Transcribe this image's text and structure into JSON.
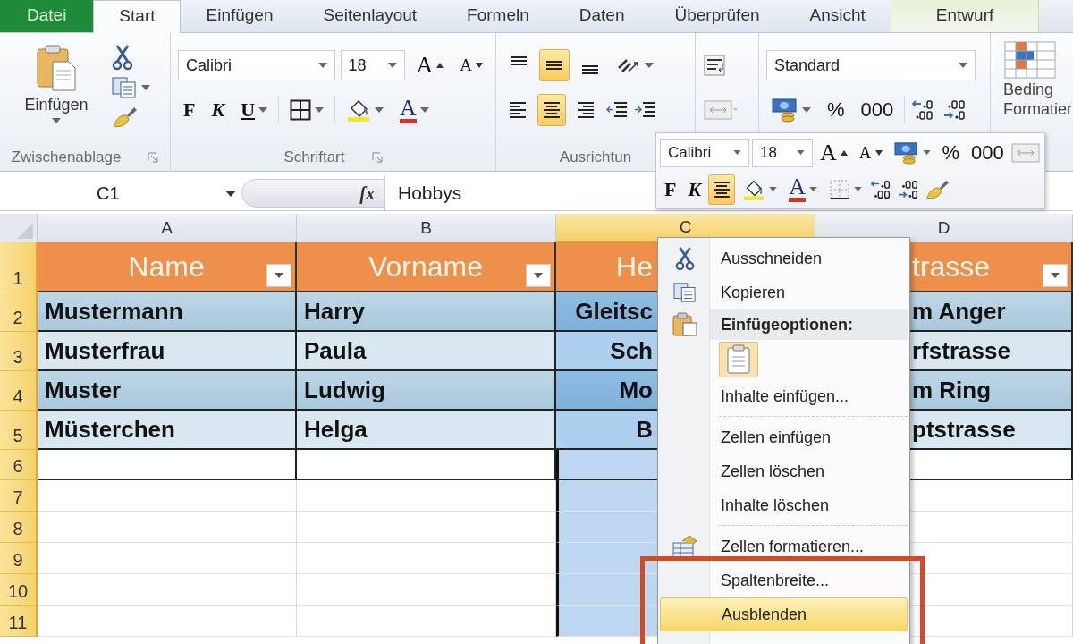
{
  "tabs": [
    {
      "label": "Datei",
      "kind": "file",
      "selected": false
    },
    {
      "label": "Start",
      "kind": "normal",
      "selected": true
    },
    {
      "label": "Einfügen",
      "kind": "normal",
      "selected": false
    },
    {
      "label": "Seitenlayout",
      "kind": "normal",
      "selected": false
    },
    {
      "label": "Formeln",
      "kind": "normal",
      "selected": false
    },
    {
      "label": "Daten",
      "kind": "normal",
      "selected": false
    },
    {
      "label": "Überprüfen",
      "kind": "normal",
      "selected": false
    },
    {
      "label": "Ansicht",
      "kind": "normal",
      "selected": false
    },
    {
      "label": "Entwurf",
      "kind": "contextual",
      "selected": false
    }
  ],
  "ribbon": {
    "clipboard": {
      "paste_label": "Einfügen",
      "group_label": "Zwischenablage"
    },
    "font": {
      "font_name": "Calibri",
      "font_size": "18",
      "grow": "A",
      "shrink": "A",
      "bold": "F",
      "italic": "K",
      "underline": "U",
      "font_color": "A",
      "group_label": "Schriftart"
    },
    "alignment": {
      "buttons": [
        {
          "selected": false
        },
        {
          "selected": true
        },
        {
          "selected": false
        },
        {
          "selected": false
        },
        {
          "selected": true
        },
        {
          "selected": false
        }
      ],
      "group_label": "Ausrichtun"
    },
    "number": {
      "format": "Standard",
      "percent": "%",
      "thousands": "000"
    },
    "styles": {
      "lines": [
        "Beding",
        "Formatier"
      ]
    }
  },
  "formula_bar": {
    "cell": "C1",
    "fx": "fx",
    "value": "Hobbys"
  },
  "mini_toolbar": {
    "font_name": "Calibri",
    "font_size": "18",
    "grow": "A",
    "shrink": "A",
    "percent": "%",
    "thousands": "000",
    "bold": "F",
    "italic": "K",
    "center_selected": true,
    "font_color": "A"
  },
  "sheet": {
    "columns": [
      {
        "label": "A",
        "selected": false
      },
      {
        "label": "B",
        "selected": false
      },
      {
        "label": "C",
        "selected": true
      },
      {
        "label": "D",
        "selected": false
      }
    ],
    "rows": [
      {
        "number": "1",
        "kind": "header",
        "cells": [
          {
            "text": "Name",
            "filter": true
          },
          {
            "text": "Vorname",
            "filter": true
          },
          {
            "text": "He",
            "filter": false
          },
          {
            "text": "trasse",
            "filter": true
          }
        ]
      },
      {
        "number": "2",
        "kind": "data",
        "cells": [
          {
            "text": "Mustermann"
          },
          {
            "text": "Harry"
          },
          {
            "text": "Gleitsc"
          },
          {
            "text": "m Anger"
          }
        ]
      },
      {
        "number": "3",
        "kind": "data",
        "cells": [
          {
            "text": "Musterfrau"
          },
          {
            "text": "Paula"
          },
          {
            "text": "Sch"
          },
          {
            "text": "rfstrasse"
          }
        ]
      },
      {
        "number": "4",
        "kind": "data",
        "cells": [
          {
            "text": "Muster"
          },
          {
            "text": "Ludwig"
          },
          {
            "text": "Mo"
          },
          {
            "text": "m Ring"
          }
        ]
      },
      {
        "number": "5",
        "kind": "data",
        "cells": [
          {
            "text": "Müsterchen"
          },
          {
            "text": "Helga"
          },
          {
            "text": "B"
          },
          {
            "text": "ptstrasse"
          }
        ]
      },
      {
        "number": "6",
        "kind": "table-blank",
        "cells": [
          {},
          {},
          {},
          {}
        ]
      },
      {
        "number": "7",
        "kind": "blank",
        "cells": [
          {},
          {},
          {},
          {}
        ]
      },
      {
        "number": "8",
        "kind": "blank",
        "cells": [
          {},
          {},
          {},
          {}
        ]
      },
      {
        "number": "9",
        "kind": "blank",
        "cells": [
          {},
          {},
          {},
          {}
        ]
      },
      {
        "number": "10",
        "kind": "blank",
        "cells": [
          {},
          {},
          {},
          {}
        ]
      },
      {
        "number": "11",
        "kind": "blank",
        "cells": [
          {},
          {},
          {},
          {}
        ]
      }
    ]
  },
  "context_menu": {
    "items": [
      {
        "kind": "command",
        "label": "Ausschneiden",
        "selected": false
      },
      {
        "kind": "command",
        "label": "Kopieren",
        "selected": false
      },
      {
        "kind": "header",
        "label": "Einfügeoptionen:"
      },
      {
        "kind": "paste-options",
        "selected": false
      },
      {
        "kind": "command",
        "label": "Inhalte einfügen...",
        "selected": false
      },
      {
        "kind": "separator"
      },
      {
        "kind": "command",
        "label": "Zellen einfügen",
        "selected": false
      },
      {
        "kind": "command",
        "label": "Zellen löschen",
        "selected": false
      },
      {
        "kind": "command",
        "label": "Inhalte löschen",
        "selected": false
      },
      {
        "kind": "separator"
      },
      {
        "kind": "command",
        "label": "Zellen formatieren...",
        "selected": false
      },
      {
        "kind": "command",
        "label": "Spaltenbreite...",
        "selected": false
      },
      {
        "kind": "command",
        "label": "Ausblenden",
        "selected": true
      }
    ]
  }
}
